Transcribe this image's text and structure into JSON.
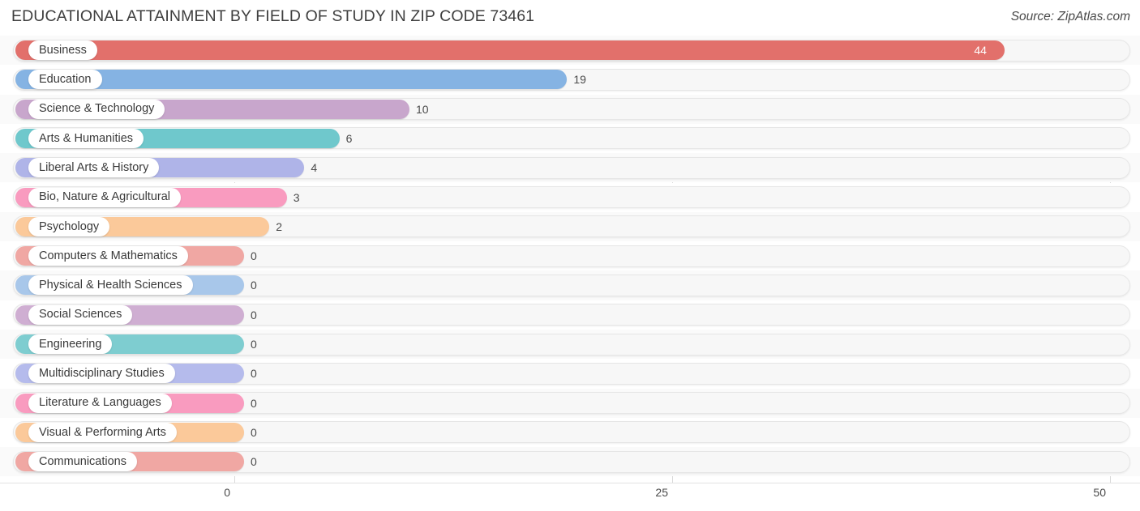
{
  "header": {
    "title": "EDUCATIONAL ATTAINMENT BY FIELD OF STUDY IN ZIP CODE 73461",
    "source": "Source: ZipAtlas.com"
  },
  "chart_data": {
    "type": "bar",
    "orientation": "horizontal",
    "title": "EDUCATIONAL ATTAINMENT BY FIELD OF STUDY IN ZIP CODE 73461",
    "xlabel": "",
    "ylabel": "",
    "xlim": [
      0,
      50
    ],
    "ticks": [
      "0",
      "25",
      "50"
    ],
    "tick_values": [
      0,
      25,
      50
    ],
    "grid": true,
    "legend": "none",
    "categories": [
      "Business",
      "Education",
      "Science & Technology",
      "Arts & Humanities",
      "Liberal Arts & History",
      "Bio, Nature & Agricultural",
      "Psychology",
      "Computers & Mathematics",
      "Physical & Health Sciences",
      "Social Sciences",
      "Engineering",
      "Multidisciplinary Studies",
      "Literature & Languages",
      "Visual & Performing Arts",
      "Communications"
    ],
    "values": [
      44,
      19,
      10,
      6,
      4,
      3,
      2,
      0,
      0,
      0,
      0,
      0,
      0,
      0,
      0
    ],
    "value_labels": [
      "44",
      "19",
      "10",
      "6",
      "4",
      "3",
      "2",
      "0",
      "0",
      "0",
      "0",
      "0",
      "0",
      "0",
      "0"
    ],
    "colors": [
      "#e2706b",
      "#85b3e3",
      "#c8a6cc",
      "#6fc8cc",
      "#afb4e8",
      "#f99bbf",
      "#fbc99a",
      "#f0a7a3",
      "#a8c7ea",
      "#cfaed2",
      "#7ecdd0",
      "#b5bbec",
      "#f99bbf",
      "#fbc99a",
      "#f0a7a3"
    ]
  }
}
